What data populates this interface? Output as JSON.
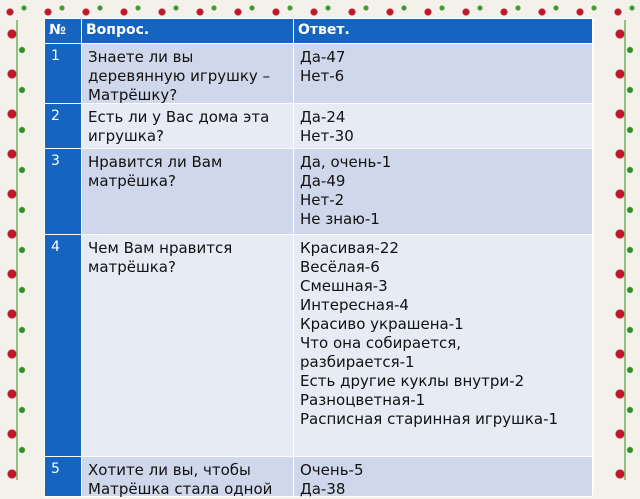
{
  "header": {
    "number": "№",
    "question": "Вопрос.",
    "answer": "Ответ."
  },
  "rows": [
    {
      "number": "1",
      "question": "Знаете ли вы деревянную игрушку – Матрёшку?",
      "answers": [
        "Да-47",
        "Нет-6"
      ]
    },
    {
      "number": "2",
      "question": "Есть ли у Вас дома эта игрушка?",
      "answers": [
        "Да-24",
        "Нет-30"
      ]
    },
    {
      "number": "3",
      "question": "Нравится  ли  Вам матрёшка?",
      "answers": [
        "Да, очень-1",
        "Да-49",
        "Нет-2",
        "Не знаю-1"
      ]
    },
    {
      "number": "4",
      "question": "Чем Вам нравится матрёшка?",
      "answers": [
        "Красивая-22",
        "Весёлая-6",
        "Смешная-3",
        "Интересная-4",
        "Красиво украшена-1",
        "Что она собирается, разбирается-1",
        "Есть другие куклы внутри-2",
        "Разноцветная-1",
        "Расписная старинная игрушка-1"
      ]
    },
    {
      "number": "5",
      "question": "Хотите ли вы, чтобы Матрёшка стала одной",
      "answers": [
        "Очень-5",
        "Да-38"
      ]
    }
  ],
  "colors": {
    "header_blue": "#1565c0",
    "row_shade": "#cfd8ea",
    "row_light": "#e6ebf5",
    "ornament_red": "#c0182a",
    "ornament_green": "#3b9a2c"
  }
}
